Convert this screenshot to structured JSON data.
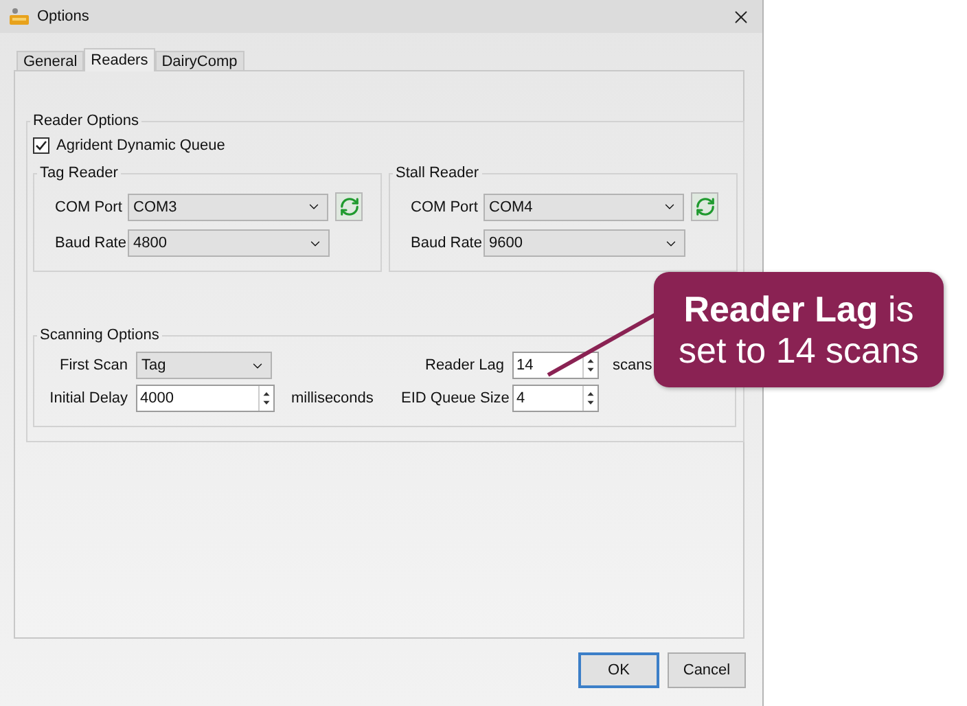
{
  "window": {
    "title": "Options"
  },
  "tabs": [
    {
      "label": "General",
      "selected": false
    },
    {
      "label": "Readers",
      "selected": true
    },
    {
      "label": "DairyComp",
      "selected": false
    }
  ],
  "reader_options": {
    "title": "Reader Options",
    "dynamic_queue": {
      "label": "Agrident Dynamic Queue",
      "checked": true
    },
    "readers": [
      {
        "title": "Tag Reader",
        "com_port": {
          "label": "COM Port",
          "value": "COM3"
        },
        "baud_rate": {
          "label": "Baud Rate",
          "value": "4800"
        }
      },
      {
        "title": "Stall Reader",
        "com_port": {
          "label": "COM Port",
          "value": "COM4"
        },
        "baud_rate": {
          "label": "Baud Rate",
          "value": "9600"
        }
      }
    ]
  },
  "scanning_options": {
    "title": "Scanning Options",
    "fields": [
      {
        "kind": "dropdown",
        "label": "First Scan",
        "value": "Tag"
      },
      {
        "kind": "spinner",
        "label": "Reader Lag",
        "value": "14",
        "unit": "scans"
      },
      {
        "kind": "spinner",
        "label": "Initial Delay",
        "value": "4000",
        "unit": "milliseconds"
      },
      {
        "kind": "spinner",
        "label": "EID Queue Size",
        "value": "4"
      }
    ]
  },
  "buttons": [
    {
      "label": "OK",
      "default": true
    },
    {
      "label": "Cancel",
      "default": false
    }
  ],
  "callout": "**Reader Lag** is set to 14 scans"
}
